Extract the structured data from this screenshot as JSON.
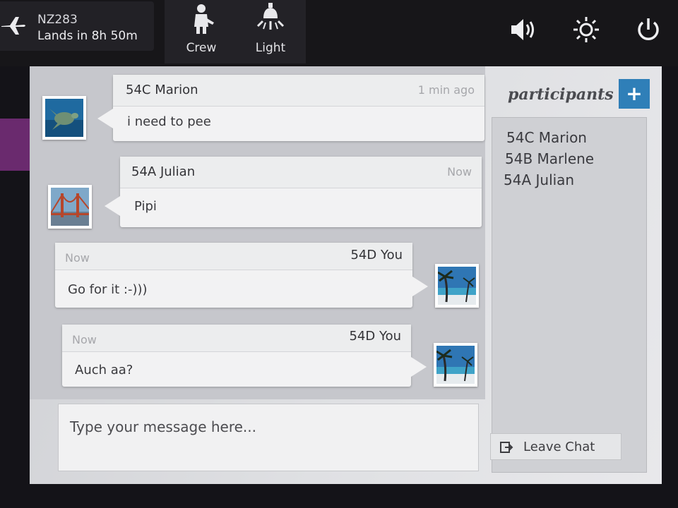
{
  "flight": {
    "number": "NZ283",
    "eta": "Lands in 8h 50m"
  },
  "controls": {
    "crew_label": "Crew",
    "light_label": "Light"
  },
  "system_icons": [
    "volume-icon",
    "brightness-icon",
    "power-icon"
  ],
  "chat": {
    "messages": [
      {
        "sender": "54C Marion",
        "time": "1 min ago",
        "text": "i need to pee",
        "side": "left",
        "avatar": "sea-turtle"
      },
      {
        "sender": "54A Julian",
        "time": "Now",
        "text": "Pipi",
        "side": "left",
        "avatar": "golden-gate-bridge"
      },
      {
        "sender": "54D You",
        "time": "Now",
        "text": "Go for it :-)))",
        "side": "right",
        "avatar": "palm-beach"
      },
      {
        "sender": "54D You",
        "time": "Now",
        "text": "Auch aa?",
        "side": "right",
        "avatar": "palm-beach"
      }
    ],
    "input_placeholder": "Type your message here..."
  },
  "participants": {
    "title": "participants",
    "add_label": "+",
    "list": [
      "54C Marion",
      "54B Marlene",
      "54A Julian"
    ]
  },
  "leave_chat": {
    "label": "Leave Chat"
  },
  "colors": {
    "accent_blue": "#2f7fb8",
    "side_accent": "#6a2a6e",
    "panel": "#dfe0e3"
  }
}
